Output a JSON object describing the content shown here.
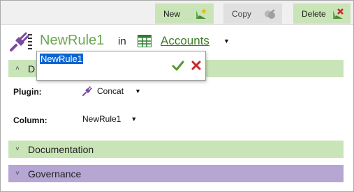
{
  "toolbar": {
    "new_label": "New",
    "copy_label": "Copy",
    "delete_label": "Delete"
  },
  "header": {
    "rule_name": "NewRule1",
    "in_label": "in",
    "table_name": "Accounts"
  },
  "editor": {
    "value": "NewRule1"
  },
  "sections": {
    "details_title": "D",
    "documentation_title": "Documentation",
    "governance_title": "Governance"
  },
  "details": {
    "plugin_label": "Plugin:",
    "plugin_value": "Concat",
    "column_label": "Column:",
    "column_value": "NewRule1"
  },
  "colors": {
    "accent_green": "#6aa84f",
    "section_green": "#c9e5b8",
    "section_purple": "#b5a6d3",
    "plug_purple": "#7a4a9c"
  }
}
